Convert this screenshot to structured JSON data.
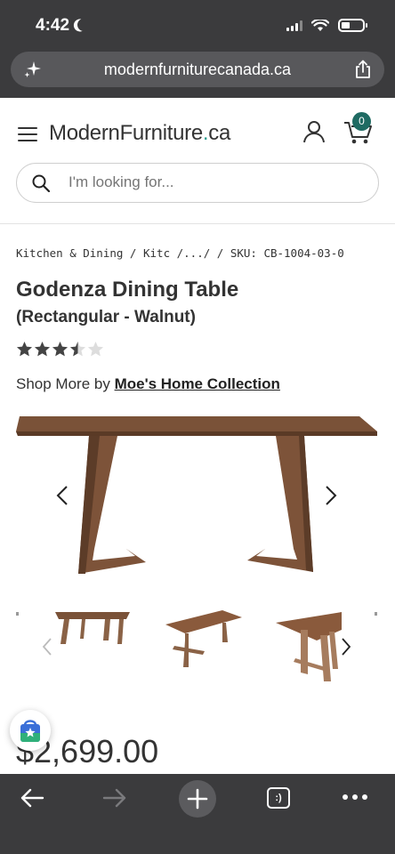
{
  "status": {
    "time": "4:42"
  },
  "browser": {
    "url": "modernfurniturecanada.ca"
  },
  "site": {
    "logo_text": "ModernFurniture",
    "logo_dot": ".",
    "logo_tld": "ca",
    "cart_count": "0",
    "search_placeholder": "I'm looking for..."
  },
  "product": {
    "breadcrumb": "Kitchen & Dining / Kitc /.../  / SKU: CB-1004-03-0",
    "title": "Godenza Dining Table",
    "subtitle": "(Rectangular - Walnut)",
    "rating": 3.5,
    "rating_max": 5,
    "shop_more_prefix": "Shop More by ",
    "brand_link": "Moe's Home Collection",
    "price": "$2,699.00"
  },
  "toolbar": {
    "tabs_label": ":)"
  },
  "colors": {
    "chrome_dark": "#3b3b3d",
    "url_pill": "#58585b",
    "brand_accent": "#1f6b63",
    "walnut": "#7a5238"
  }
}
